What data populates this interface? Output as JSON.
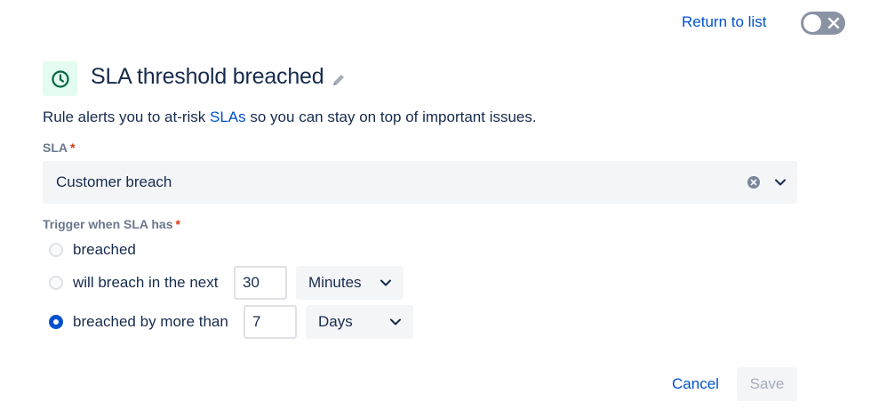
{
  "header": {
    "return_link": "Return to list",
    "toggle_enabled": false
  },
  "rule": {
    "icon": "clock-icon",
    "title": "SLA threshold breached",
    "description_prefix": "Rule alerts you to at-risk ",
    "description_link": "SLAs",
    "description_suffix": " so you can stay on top of important issues."
  },
  "sla_field": {
    "label": "SLA",
    "required_mark": "*",
    "value": "Customer breach"
  },
  "trigger": {
    "label": "Trigger when SLA has",
    "required_mark": "*",
    "options": [
      {
        "label": "breached",
        "selected": false
      },
      {
        "label": "will breach in the next",
        "selected": false,
        "amount": "30",
        "unit": "Minutes"
      },
      {
        "label": "breached by more than",
        "selected": true,
        "amount": "7",
        "unit": "Days"
      }
    ]
  },
  "footer": {
    "cancel_label": "Cancel",
    "save_label": "Save",
    "save_disabled": true
  },
  "colors": {
    "link": "#0052cc",
    "text": "#172b4d",
    "muted_label": "#6b778c",
    "required": "#de350b",
    "icon_bg": "#e3fcef",
    "icon_fg": "#006644"
  }
}
